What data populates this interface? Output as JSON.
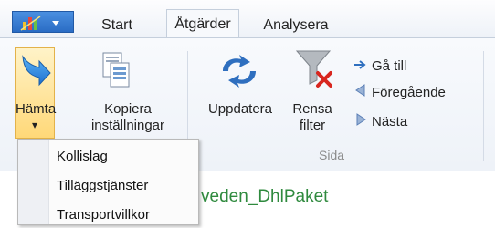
{
  "tabs": {
    "start": "Start",
    "atgarder": "Åtgärder",
    "analysera": "Analysera"
  },
  "ribbon": {
    "hamta": "Hämta",
    "hamta_arrow": "▾",
    "kopiera_line1": "Kopiera",
    "kopiera_line2": "inställningar",
    "uppdatera": "Uppdatera",
    "rensa_line1": "Rensa",
    "rensa_line2": "filter",
    "ga_till": "Gå till",
    "foregaende": "Föregående",
    "nasta": "Nästa",
    "group_sida": "Sida"
  },
  "dropdown": {
    "items": [
      "Kollislag",
      "Tilläggstjänster",
      "Transportvillkor"
    ]
  },
  "content": {
    "partial_text": "veden_DhlPaket"
  },
  "colors": {
    "accent_blue": "#2a6cc4",
    "highlight": "#ffd878",
    "content_green": "#2f8a3e"
  },
  "icons": {
    "app_menu": "bar-chart-icon",
    "hamta": "download-arrow-icon",
    "kopiera": "copy-settings-icon",
    "uppdatera": "refresh-icon",
    "rensa": "filter-clear-icon",
    "ga_till": "arrow-right-icon",
    "foregaende": "triangle-left-icon",
    "nasta": "triangle-right-icon"
  }
}
